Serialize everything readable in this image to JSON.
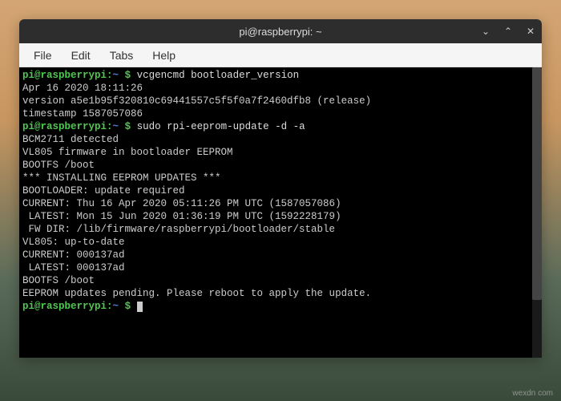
{
  "window": {
    "title": "pi@raspberrypi: ~"
  },
  "menubar": {
    "file": "File",
    "edit": "Edit",
    "tabs": "Tabs",
    "help": "Help"
  },
  "prompt": {
    "user_host": "pi@raspberrypi",
    "sep": ":",
    "path": "~",
    "dollar": " $ "
  },
  "commands": {
    "cmd1": "vcgencmd bootloader_version",
    "cmd2": "sudo rpi-eeprom-update -d -a"
  },
  "output": {
    "l1": "Apr 16 2020 18:11:26",
    "l2": "version a5e1b95f320810c69441557c5f5f0a7f2460dfb8 (release)",
    "l3": "timestamp 1587057086",
    "l4": "BCM2711 detected",
    "l5": "VL805 firmware in bootloader EEPROM",
    "l6": "BOOTFS /boot",
    "l7": "*** INSTALLING EEPROM UPDATES ***",
    "l8": "BOOTLOADER: update required",
    "l9": "CURRENT: Thu 16 Apr 2020 05:11:26 PM UTC (1587057086)",
    "l10": " LATEST: Mon 15 Jun 2020 01:36:19 PM UTC (1592228179)",
    "l11": " FW DIR: /lib/firmware/raspberrypi/bootloader/stable",
    "l12": "VL805: up-to-date",
    "l13": "CURRENT: 000137ad",
    "l14": " LATEST: 000137ad",
    "l15": "BOOTFS /boot",
    "l16": "EEPROM updates pending. Please reboot to apply the update."
  },
  "watermark": "wexdn com"
}
